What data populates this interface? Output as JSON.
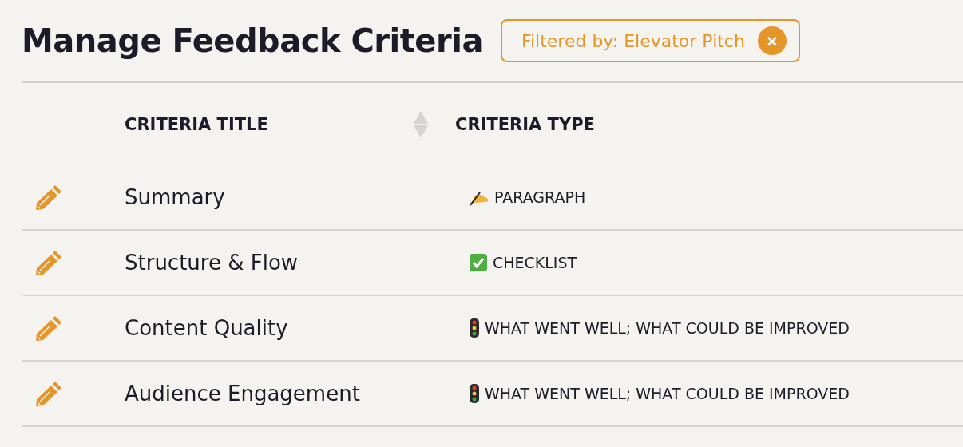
{
  "page": {
    "title": "Manage Feedback Criteria"
  },
  "filter_chip": {
    "label": "Filtered by: Elevator Pitch",
    "close": "×"
  },
  "table": {
    "columns": [
      {
        "label": "CRITERIA TITLE",
        "sortable": true
      },
      {
        "label": "CRITERIA TYPE",
        "sortable": false
      }
    ],
    "rows": [
      {
        "title": "Summary",
        "kind": "writing",
        "type": "PARAGRAPH"
      },
      {
        "title": "Structure & Flow",
        "kind": "check",
        "type": "CHECKLIST"
      },
      {
        "title": "Content Quality",
        "kind": "traffic-light",
        "type": "WHAT WENT WELL; WHAT COULD BE IMPROVED"
      },
      {
        "title": "Audience Engagement",
        "kind": "traffic-light",
        "type": "WHAT WENT WELL; WHAT COULD BE IMPROVED"
      }
    ]
  }
}
